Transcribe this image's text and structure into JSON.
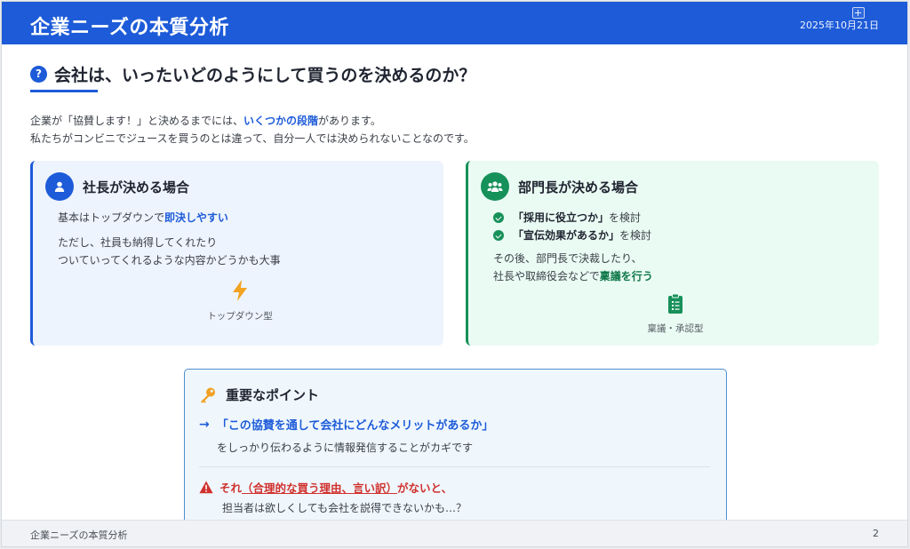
{
  "header": {
    "title": "企業ニーズの本質分析",
    "date": "2025年10月21日"
  },
  "question": {
    "icon": "question-circle-icon",
    "title": "会社は、いったいどのようにして買うのを決めるのか？"
  },
  "intro": {
    "line1_a": "企業が「協賛します！」と決めるまでには、",
    "line1_highlight": "いくつかの段階",
    "line1_b": "があります。",
    "line2": "私たちがコンビニでジュースを買うのとは違って、自分一人では決められないことなのです。"
  },
  "card_president": {
    "icon": "person-icon",
    "title": "社長が決める場合",
    "line1_a": "基本はトップダウンで",
    "line1_highlight": "即決しやすい",
    "line2": "ただし、社員も納得してくれたり",
    "line3": "ついていってくれるような内容かどうかも大事",
    "figure_icon": "lightning-icon",
    "figure_caption": "トップダウン型"
  },
  "card_manager": {
    "icon": "group-icon",
    "title": "部門長が決める場合",
    "checks": [
      {
        "bold": "「採用に役立つか」",
        "rest": "を検討"
      },
      {
        "bold": "「宣伝効果があるか」",
        "rest": "を検討"
      }
    ],
    "line1": "その後、部門長で決裁したり、",
    "line2_a": "社長や取締役会などで",
    "line2_highlight": "稟議を行う",
    "figure_icon": "clipboard-icon",
    "figure_caption": "稟議・承認型"
  },
  "key_point": {
    "icon": "key-icon",
    "title": "重要なポイント",
    "arrow": "→",
    "merit": "「この協賛を通して会社にどんなメリットがあるか」",
    "merit_sub": "をしっかり伝わるように情報発信することがカギです",
    "warn_icon": "warning-icon",
    "warn_a": "それ",
    "warn_underlined": "（合理的な買う理由、言い訳）",
    "warn_b": "がないと、",
    "warn_sub": "担当者は欲しくしても会社を説得できないかも…？"
  },
  "footer": {
    "title": "企業ニーズの本質分析",
    "page": "2"
  },
  "colors": {
    "primary": "#1d5bd8",
    "green": "#17915a",
    "warning": "#d0312d",
    "key": "#f0a023"
  }
}
